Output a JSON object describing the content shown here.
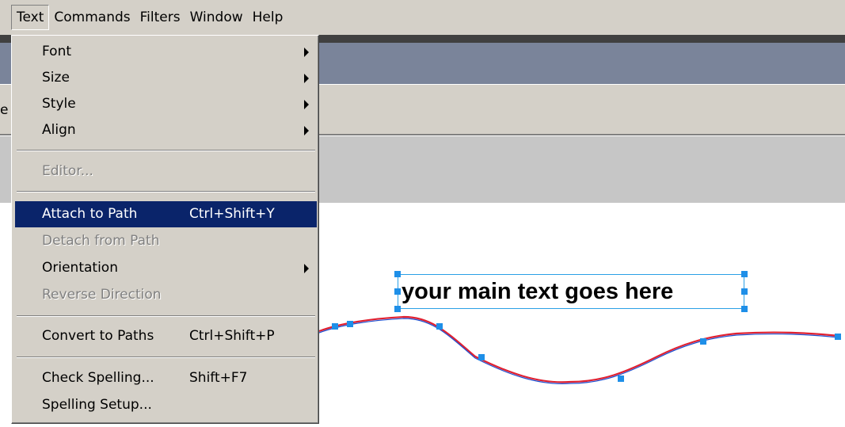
{
  "menubar": {
    "items": [
      {
        "label": "Text"
      },
      {
        "label": "Commands"
      },
      {
        "label": "Filters"
      },
      {
        "label": "Window"
      },
      {
        "label": "Help"
      }
    ]
  },
  "toolbar": {
    "fragment": "e"
  },
  "text_menu": {
    "font": "Font",
    "size": "Size",
    "style": "Style",
    "align": "Align",
    "editor": "Editor...",
    "attach": "Attach to Path",
    "attach_shortcut": "Ctrl+Shift+Y",
    "detach": "Detach from Path",
    "orientation": "Orientation",
    "reverse": "Reverse Direction",
    "convert": "Convert to Paths",
    "convert_shortcut": "Ctrl+Shift+P",
    "spell": "Check Spelling...",
    "spell_shortcut": "Shift+F7",
    "spell_setup": "Spelling Setup..."
  },
  "canvas": {
    "text": "your main text goes here"
  },
  "colors": {
    "selection": "#0a246a",
    "handle": "#1e8fe8",
    "path_red": "#e02030",
    "path_blue": "#1e4fd0"
  }
}
